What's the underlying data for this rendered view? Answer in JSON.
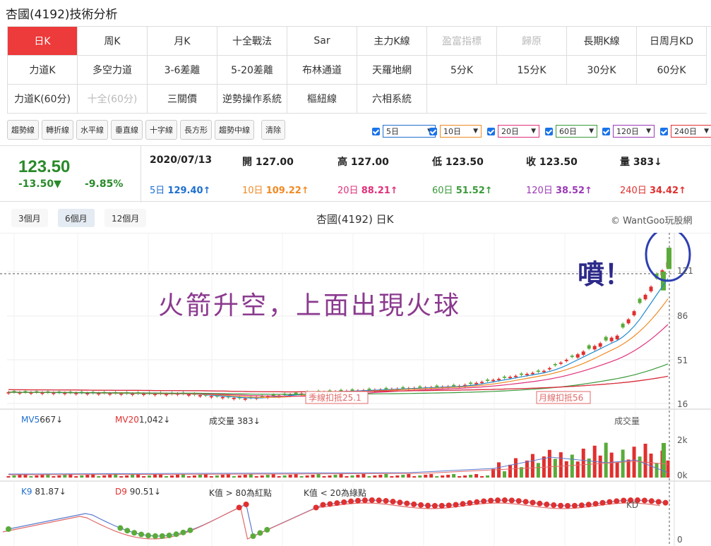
{
  "page": {
    "title": "杏國(4192)技術分析"
  },
  "tabs": {
    "row1": [
      "日K",
      "周K",
      "月K",
      "十全戰法",
      "Sar",
      "主力K線",
      "盈富指標",
      "歸原",
      "長期K線",
      "日周月KD"
    ],
    "row2": [
      "力道K",
      "多空力道",
      "3-6差離",
      "5-20差離",
      "布林通道",
      "天羅地網",
      "5分K",
      "15分K",
      "30分K",
      "60分K"
    ],
    "row3": [
      "力道K(60分)",
      "十全(60分)",
      "三關價",
      "逆勢操作系統",
      "樞紐線",
      "六相系統"
    ]
  },
  "tools": [
    "趨勢線",
    "轉折線",
    "水平線",
    "垂直線",
    "十字線",
    "長方形",
    "趨勢中線",
    "清除"
  ],
  "ma_selects": [
    {
      "label": "5日",
      "color": "#1f6fd0"
    },
    {
      "label": "10日",
      "color": "#f08a24"
    },
    {
      "label": "20日",
      "color": "#e0307a"
    },
    {
      "label": "60日",
      "color": "#3a9a3a"
    },
    {
      "label": "120日",
      "color": "#9b3ab5"
    },
    {
      "label": "240日",
      "color": "#e03030"
    }
  ],
  "quote": {
    "price": "123.50",
    "change": "-13.50▼",
    "pct": "-9.85%",
    "date": "2020/07/13",
    "open": "開 127.00",
    "high": "高 127.00",
    "low": "低 123.50",
    "close": "收 123.50",
    "volume": "量 383↓",
    "ma5": {
      "label": "5日",
      "value": "129.40↑"
    },
    "ma10": {
      "label": "10日",
      "value": "109.22↑"
    },
    "ma20": {
      "label": "20日",
      "value": "88.21↑"
    },
    "ma60": {
      "label": "60日",
      "value": "51.52↑"
    },
    "ma120": {
      "label": "120日",
      "value": "38.52↑"
    },
    "ma240": {
      "label": "240日",
      "value": "34.42↑"
    }
  },
  "periods": [
    "3個月",
    "6個月",
    "12個月"
  ],
  "chart": {
    "title": "杏國(4192) 日K",
    "copyright": "© WantGoo玩股網",
    "annotation": "火箭升空，上面出現火球",
    "exclaim": "噴！",
    "price_axis": [
      "121",
      "86",
      "51",
      "16"
    ],
    "marker1": "季線扣抵25.1",
    "marker2": "月線扣抵56",
    "vol_labels": {
      "mv5": "MV5",
      "mv5_val": "667↓",
      "mv20": "MV20",
      "mv20_val": "1,042↓",
      "vol": "成交量 383↓",
      "vol_right": "成交量"
    },
    "vol_axis": [
      "2k",
      "0k"
    ],
    "kd_labels": {
      "k9": "K9",
      "k9_val": "81.87↓",
      "d9": "D9",
      "d9_val": "90.51↓",
      "note1": "K值 > 80為紅點",
      "note2": "K值 < 20為綠點",
      "kd": "KD"
    },
    "kd_axis": [
      "0"
    ]
  },
  "colors": {
    "up": "#e0302f",
    "down": "#5aab3a",
    "active_tab": "#ed3a3a"
  }
}
